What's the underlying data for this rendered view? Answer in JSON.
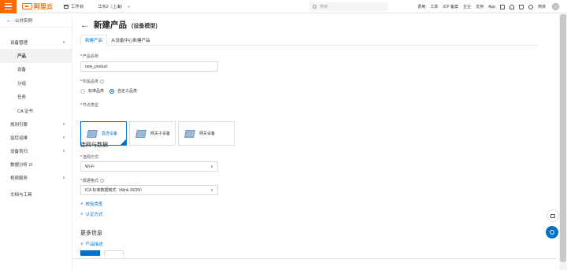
{
  "topbar": {
    "logo_text": "阿里云",
    "workbench": "工作台",
    "region": "华东2（上海）",
    "search_placeholder": "搜索",
    "links": [
      "费用",
      "工单",
      "ICP 备案",
      "企业",
      "支持",
      "App"
    ],
    "user": "简体"
  },
  "sidebar": {
    "back_label": "公共实例",
    "device_mgmt": "设备管理",
    "items": [
      {
        "label": "产品",
        "active": true
      },
      {
        "label": "设备",
        "active": false
      },
      {
        "label": "分组",
        "active": false
      },
      {
        "label": "任务",
        "active": false
      },
      {
        "label": "CA 证书",
        "active": false
      }
    ],
    "groups": [
      "规则引擎",
      "监控运维",
      "设备划归",
      "数据分析 ☑",
      "视频服务",
      "文档与工具"
    ]
  },
  "page": {
    "title": "新建产品",
    "subtitle": "(设备模型)",
    "tabs": [
      "新建产品",
      "从设备中心新建产品"
    ],
    "product_name_label": "产品名称",
    "product_name_value": "new_product",
    "category_label": "所属品类",
    "category_options": [
      "标准品类",
      "自定义品类"
    ],
    "category_selected": 1,
    "node_type_label": "节点类型",
    "node_types": [
      "直连设备",
      "网关子设备",
      "网关设备"
    ],
    "node_type_selected": 0,
    "network_section": "连网与数据",
    "network_method_label": "连网方式",
    "network_method_value": "Wi-Fi",
    "data_format_label": "数据格式",
    "data_format_value": "ICA 标准数据格式（Alink JSON）",
    "validation_link": "校验类型",
    "auth_link": "认证方式",
    "more_section": "更多信息",
    "description_link": "产品描述"
  },
  "colors": {
    "brand": "#ff6a00",
    "primary": "#0070cc"
  }
}
